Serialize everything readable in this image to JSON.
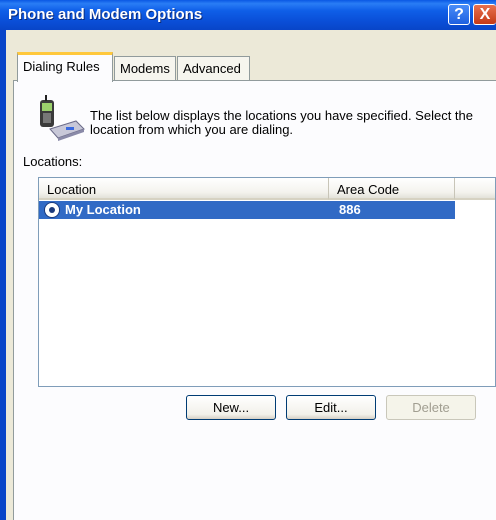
{
  "window": {
    "title": "Phone and Modem Options",
    "help_glyph": "?",
    "close_glyph": "X"
  },
  "tabs": [
    {
      "label": "Dialing Rules",
      "active": true
    },
    {
      "label": "Modems",
      "active": false
    },
    {
      "label": "Advanced",
      "active": false
    }
  ],
  "dialing_rules": {
    "intro_text": "The list below displays the locations you have specified. Select the location from which you are dialing.",
    "locations_label": "Locations:",
    "columns": [
      "Location",
      "Area Code"
    ],
    "rows": [
      {
        "location": "My Location",
        "area_code": "886",
        "selected": true
      }
    ],
    "buttons": {
      "new": "New...",
      "edit": "Edit...",
      "delete": "Delete"
    }
  },
  "colors": {
    "title_bar": "#0a4fd8",
    "selection": "#316ac5",
    "active_tab_accent": "#ffc83c",
    "dialog_bg": "#ece9d8"
  }
}
